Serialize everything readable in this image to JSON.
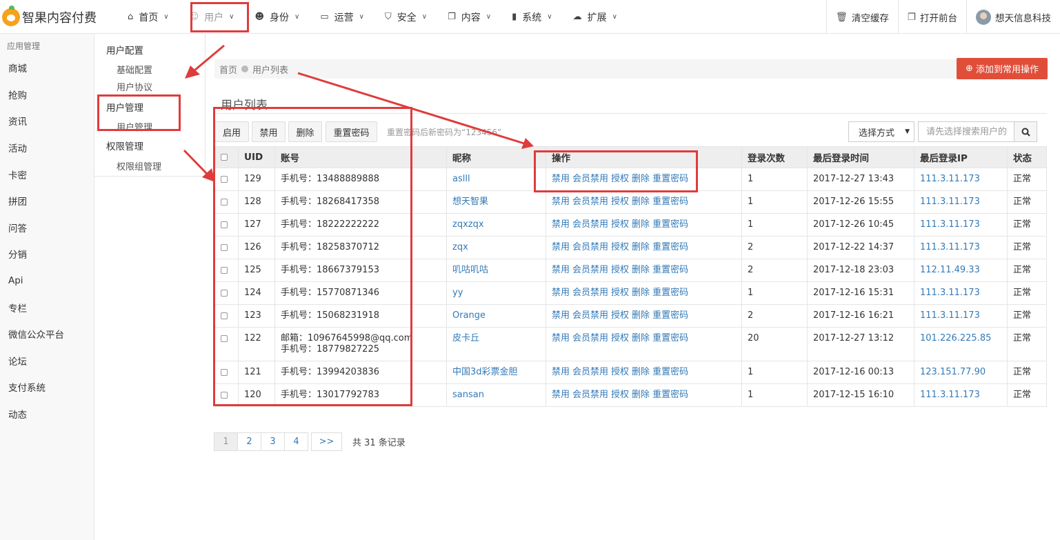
{
  "app": {
    "title": "智果内容付费"
  },
  "topnav": [
    {
      "label": "首页",
      "icon": "home-icon"
    },
    {
      "label": "用户",
      "icon": "user-icon"
    },
    {
      "label": "身份",
      "icon": "users-icon"
    },
    {
      "label": "运营",
      "icon": "monitor-icon"
    },
    {
      "label": "安全",
      "icon": "shield-icon"
    },
    {
      "label": "内容",
      "icon": "copy-icon"
    },
    {
      "label": "系统",
      "icon": "book-icon"
    },
    {
      "label": "扩展",
      "icon": "cloud-icon"
    }
  ],
  "topright": {
    "clear_cache": "清空缓存",
    "open_front": "打开前台",
    "user_name": "想天信息科技"
  },
  "sidebar": {
    "title": "应用管理",
    "items": [
      "商城",
      "抢购",
      "资讯",
      "活动",
      "卡密",
      "拼团",
      "问答",
      "分销",
      "Api",
      "专栏",
      "微信公众平台",
      "论坛",
      "支付系统",
      "动态"
    ]
  },
  "subside": {
    "group1": "用户配置",
    "g1_item1": "基础配置",
    "g1_item2": "用户协议",
    "group2": "用户管理",
    "g2_item1": "用户管理",
    "group3": "权限管理",
    "g3_item1": "权限组管理"
  },
  "breadcrumb": {
    "home": "首页",
    "current": "用户列表"
  },
  "add_button": "添加到常用操作",
  "page_title": "用户列表",
  "toolbar": {
    "enable": "启用",
    "disable": "禁用",
    "delete": "删除",
    "reset_pwd": "重置密码",
    "hint": "重置密码后新密码为“123456”"
  },
  "search": {
    "select_label": "选择方式",
    "placeholder": "请先选择搜索用户的"
  },
  "table": {
    "headers": [
      "UID",
      "账号",
      "昵称",
      "操作",
      "登录次数",
      "最后登录时间",
      "最后登录IP",
      "状态"
    ],
    "actions": [
      "禁用",
      "会员禁用",
      "授权",
      "删除",
      "重置密码"
    ],
    "rows": [
      {
        "uid": "129",
        "account": "手机号：13488889888",
        "account2": "",
        "nickname": "aslll",
        "logins": "1",
        "last_time": "2017-12-27 13:43",
        "last_ip": "111.3.11.173",
        "status": "正常"
      },
      {
        "uid": "128",
        "account": "手机号：18268417358",
        "account2": "",
        "nickname": "想天智果",
        "logins": "1",
        "last_time": "2017-12-26 15:55",
        "last_ip": "111.3.11.173",
        "status": "正常"
      },
      {
        "uid": "127",
        "account": "手机号：18222222222",
        "account2": "",
        "nickname": "zqxzqx",
        "logins": "1",
        "last_time": "2017-12-26 10:45",
        "last_ip": "111.3.11.173",
        "status": "正常"
      },
      {
        "uid": "126",
        "account": "手机号：18258370712",
        "account2": "",
        "nickname": "zqx",
        "logins": "2",
        "last_time": "2017-12-22 14:37",
        "last_ip": "111.3.11.173",
        "status": "正常"
      },
      {
        "uid": "125",
        "account": "手机号：18667379153",
        "account2": "",
        "nickname": "叽咕叽咕",
        "logins": "2",
        "last_time": "2017-12-18 23:03",
        "last_ip": "112.11.49.33",
        "status": "正常"
      },
      {
        "uid": "124",
        "account": "手机号：15770871346",
        "account2": "",
        "nickname": "yy",
        "logins": "1",
        "last_time": "2017-12-16 15:31",
        "last_ip": "111.3.11.173",
        "status": "正常"
      },
      {
        "uid": "123",
        "account": "手机号：15068231918",
        "account2": "",
        "nickname": "Orange",
        "logins": "2",
        "last_time": "2017-12-16 16:21",
        "last_ip": "111.3.11.173",
        "status": "正常"
      },
      {
        "uid": "122",
        "account": "邮箱：10967645998@qq.com",
        "account2": "手机号：18779827225",
        "nickname": "皮卡丘",
        "logins": "20",
        "last_time": "2017-12-27 13:12",
        "last_ip": "101.226.225.85",
        "status": "正常"
      },
      {
        "uid": "121",
        "account": "手机号：13994203836",
        "account2": "",
        "nickname": "中国3d彩票金胆",
        "logins": "1",
        "last_time": "2017-12-16 00:13",
        "last_ip": "123.151.77.90",
        "status": "正常"
      },
      {
        "uid": "120",
        "account": "手机号：13017792783",
        "account2": "",
        "nickname": "sansan",
        "logins": "1",
        "last_time": "2017-12-15 16:10",
        "last_ip": "111.3.11.173",
        "status": "正常"
      }
    ]
  },
  "pagination": {
    "pages": [
      "1",
      "2",
      "3",
      "4"
    ],
    "next": ">>",
    "total": "共 31 条记录"
  },
  "colors": {
    "accent": "#e04e39",
    "link": "#337ab7",
    "annotation": "#e03b3b"
  }
}
